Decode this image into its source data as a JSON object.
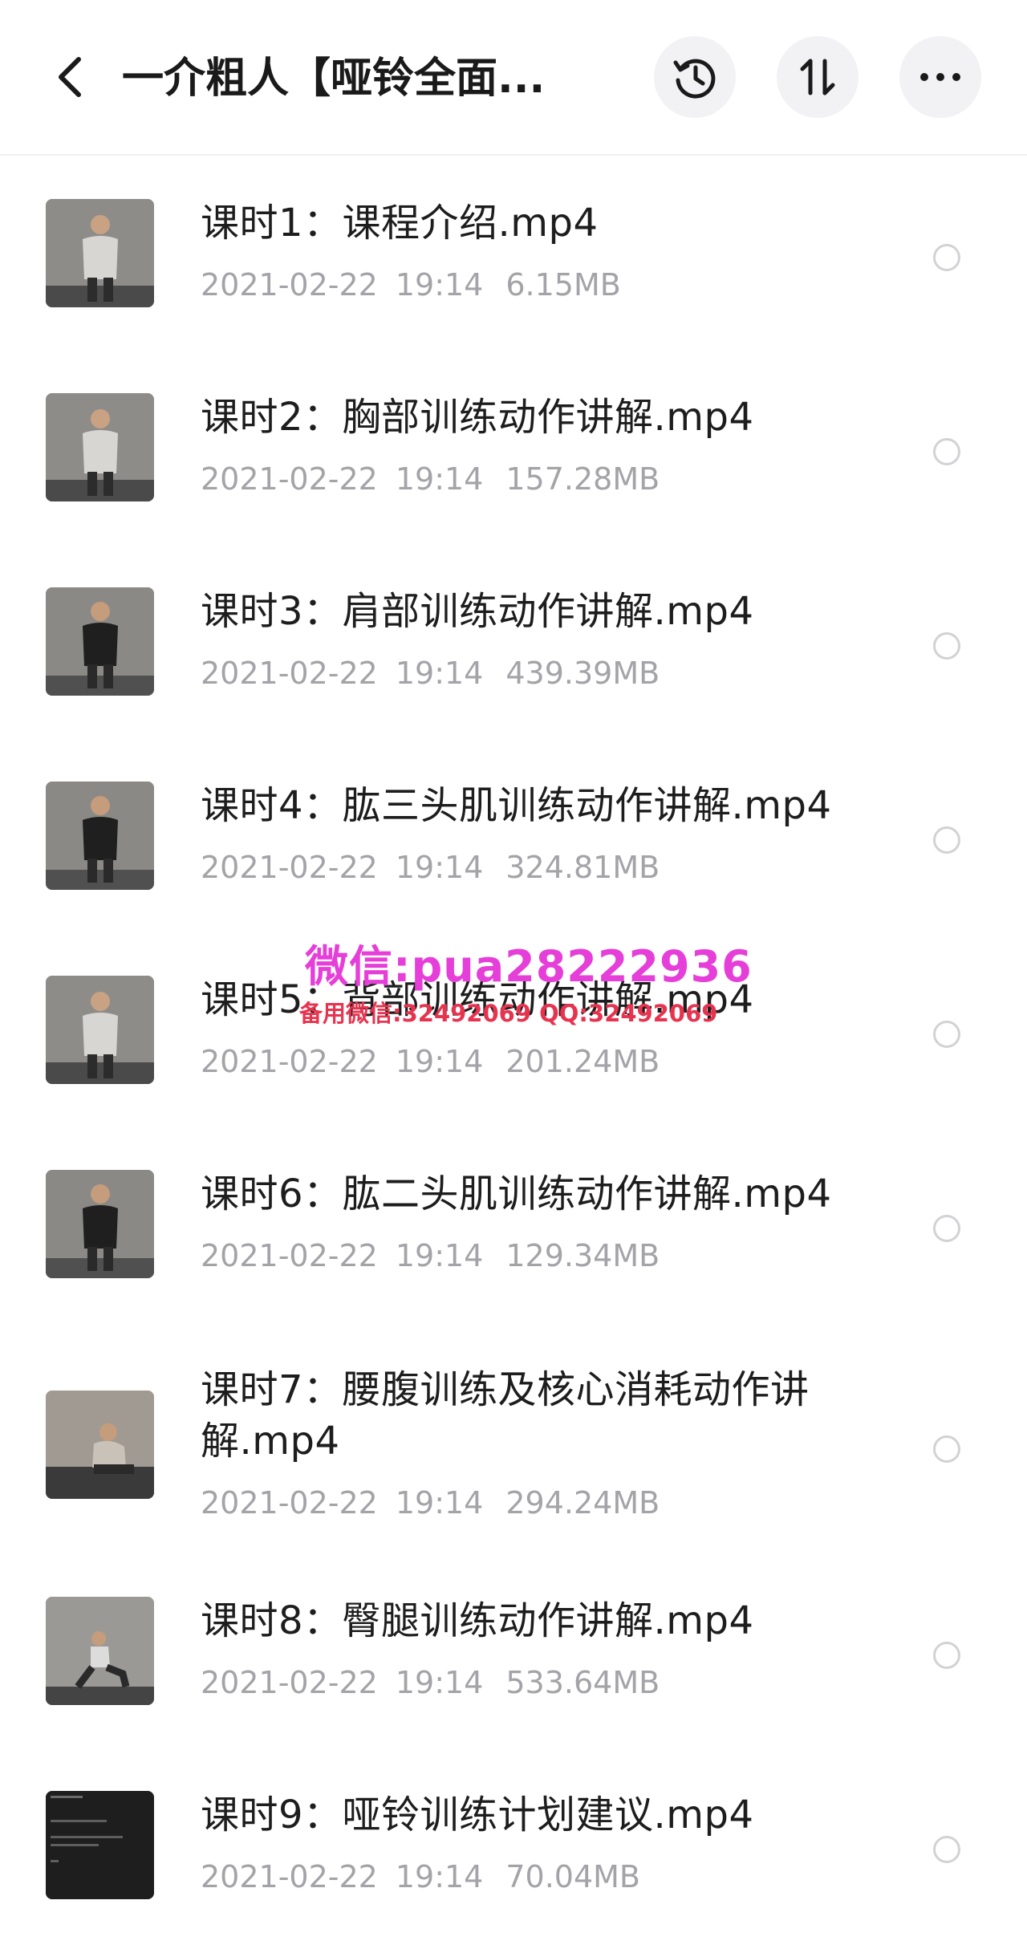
{
  "header": {
    "title": "一介粗人【哑铃全面...",
    "back_icon": "chevron-left-icon",
    "history_icon": "history-clock-icon",
    "sort_icon": "sort-arrows-icon",
    "more_icon": "more-dots-icon"
  },
  "files": [
    {
      "name": "课时1：课程介绍.mp4",
      "date": "2021-02-22",
      "time": "19:14",
      "size": "6.15MB",
      "thumb": "light"
    },
    {
      "name": "课时2：胸部训练动作讲解.mp4",
      "date": "2021-02-22",
      "time": "19:14",
      "size": "157.28MB",
      "thumb": "light"
    },
    {
      "name": "课时3：肩部训练动作讲解.mp4",
      "date": "2021-02-22",
      "time": "19:14",
      "size": "439.39MB",
      "thumb": "dark-shirt"
    },
    {
      "name": "课时4：肱三头肌训练动作讲解.mp4",
      "date": "2021-02-22",
      "time": "19:14",
      "size": "324.81MB",
      "thumb": "dark-shirt"
    },
    {
      "name": "课时5：背部训练动作讲解.mp4",
      "date": "2021-02-22",
      "time": "19:14",
      "size": "201.24MB",
      "thumb": "light"
    },
    {
      "name": "课时6：肱二头肌训练动作讲解.mp4",
      "date": "2021-02-22",
      "time": "19:14",
      "size": "129.34MB",
      "thumb": "dark-shirt"
    },
    {
      "name": "课时7：腰腹训练及核心消耗动作讲解.mp4",
      "date": "2021-02-22",
      "time": "19:14",
      "size": "294.24MB",
      "thumb": "floor"
    },
    {
      "name": "课时8：臀腿训练动作讲解.mp4",
      "date": "2021-02-22",
      "time": "19:14",
      "size": "533.64MB",
      "thumb": "lunge"
    },
    {
      "name": "课时9：哑铃训练计划建议.mp4",
      "date": "2021-02-22",
      "time": "19:14",
      "size": "70.04MB",
      "thumb": "document"
    }
  ],
  "watermark": {
    "line1": "微信:pua28222936",
    "line2": "备用微信:32492069 QQ:32492069"
  },
  "colors": {
    "meta_text": "#a3a3a8",
    "watermark_main": "#e63ed8",
    "watermark_sub": "#e8334f"
  }
}
